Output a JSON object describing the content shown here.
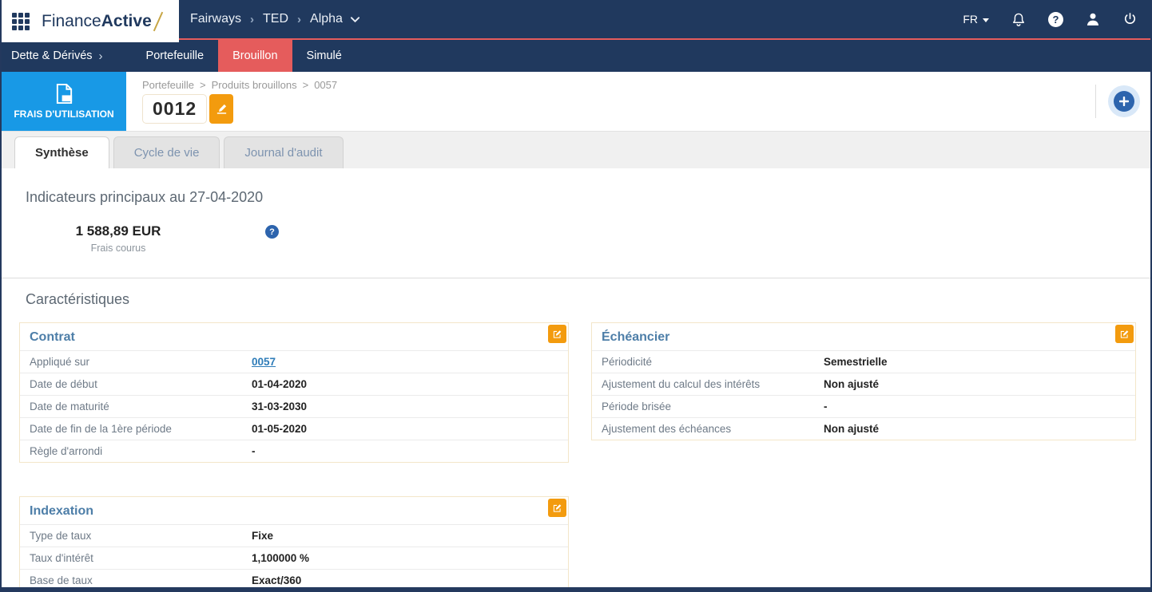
{
  "topbar": {
    "logo": {
      "regular": "Finance",
      "bold": "Active"
    },
    "crumb_separator": "›",
    "crumbs": [
      "Fairways",
      "TED",
      "Alpha"
    ],
    "language": "FR"
  },
  "nav": {
    "section_label": "Dette & Dérivés",
    "section_chevron": "›",
    "items": [
      {
        "label": "Portefeuille",
        "active": false
      },
      {
        "label": "Brouillon",
        "active": true
      },
      {
        "label": "Simulé",
        "active": false
      }
    ]
  },
  "header": {
    "module_label": "FRAIS D'UTILISATION",
    "breadcrumb_separator": ">",
    "breadcrumb": [
      "Portefeuille",
      "Produits brouillons",
      "0057"
    ],
    "code": "0012"
  },
  "tabs": [
    {
      "label": "Synthèse",
      "active": true
    },
    {
      "label": "Cycle de vie",
      "active": false
    },
    {
      "label": "Journal d'audit",
      "active": false
    }
  ],
  "indicators": {
    "title": "Indicateurs principaux au 27-04-2020",
    "value": "1 588,89 EUR",
    "caption": "Frais courus"
  },
  "icons": {
    "help_glyph": "?"
  },
  "characteristics": {
    "title": "Caractéristiques",
    "cards": {
      "contrat": {
        "title": "Contrat",
        "rows": [
          {
            "label": "Appliqué sur",
            "value": "0057"
          },
          {
            "label": "Date de début",
            "value": "01-04-2020"
          },
          {
            "label": "Date de maturité",
            "value": "31-03-2030"
          },
          {
            "label": "Date de fin de la 1ère période",
            "value": "01-05-2020"
          },
          {
            "label": "Règle d'arrondi",
            "value": "-"
          }
        ]
      },
      "echeancier": {
        "title": "Échéancier",
        "rows": [
          {
            "label": "Périodicité",
            "value": "Semestrielle"
          },
          {
            "label": "Ajustement du calcul des intérêts",
            "value": "Non ajusté"
          },
          {
            "label": "Période brisée",
            "value": "-"
          },
          {
            "label": "Ajustement des échéances",
            "value": "Non ajusté"
          }
        ]
      },
      "indexation": {
        "title": "Indexation",
        "rows": [
          {
            "label": "Type de taux",
            "value": "Fixe"
          },
          {
            "label": "Taux d'intérêt",
            "value": "1,100000 %"
          },
          {
            "label": "Base de taux",
            "value": "Exact/360"
          }
        ]
      }
    }
  },
  "colors": {
    "navy": "#20395e",
    "red_accent": "#e55c5c",
    "bright_blue": "#1899e6",
    "orange": "#f39b0e",
    "link_blue": "#2e7cb8",
    "card_title_blue": "#4d7ea8",
    "help_blue": "#2d64ad",
    "gold": "#c7a544"
  }
}
